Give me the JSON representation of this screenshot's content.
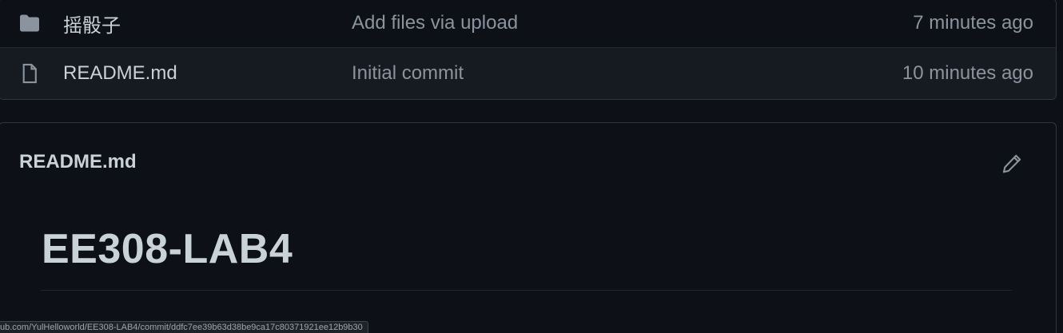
{
  "files": [
    {
      "icon": "folder-icon",
      "name": "摇骰子",
      "message": "Add files via upload",
      "time": "7 minutes ago"
    },
    {
      "icon": "file-icon",
      "name": "README.md",
      "message": "Initial commit",
      "time": "10 minutes ago"
    }
  ],
  "readme": {
    "title": "README.md",
    "edit_icon": "pencil-icon",
    "heading": "EE308-LAB4"
  },
  "status_bar": {
    "url": "ub.com/YulHelloworld/EE308-LAB4/commit/ddfc7ee39b63d38be9ca17c80371921ee12b9b30"
  },
  "colors": {
    "background": "#0d1117",
    "row_alt": "#161b22",
    "border": "#30363d",
    "text": "#c9d1d9",
    "muted": "#8b949e"
  }
}
